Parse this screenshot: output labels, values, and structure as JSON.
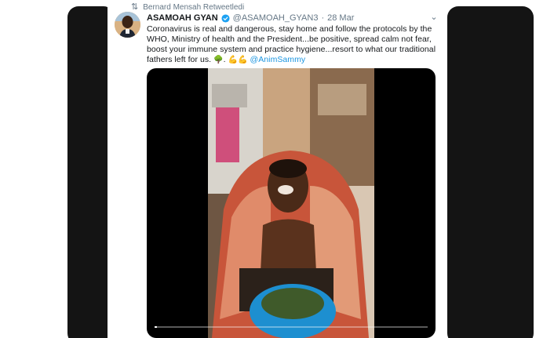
{
  "retweet": {
    "icon": "retweet-icon",
    "text": "Bernard Mensah Retweetledi"
  },
  "tweet": {
    "author": {
      "display_name": "ASAMOAH GYAN",
      "verified": true,
      "handle": "@ASAMOAH_GYAN3",
      "separator": "·",
      "date": "28 Mar"
    },
    "text_before_emoji": "Coronavirus is real and dangerous, stay home and follow the protocols by the WHO, Ministry of health and the President...be positive, spread calm not fear, boost your immune system and practice hygiene...resort to what our traditional fathers left for us.",
    "emoji_tree": "🌳",
    "dot": ".",
    "emoji_muscle": "💪💪",
    "mention": "@AnimSammy",
    "media": {
      "type": "video",
      "progress": 0.01
    }
  },
  "colors": {
    "accent": "#1b95e0",
    "secondary_text": "#657786",
    "primary_text": "#14171a",
    "verified": "#1da1f2",
    "backdrop_panels": "#141414"
  }
}
